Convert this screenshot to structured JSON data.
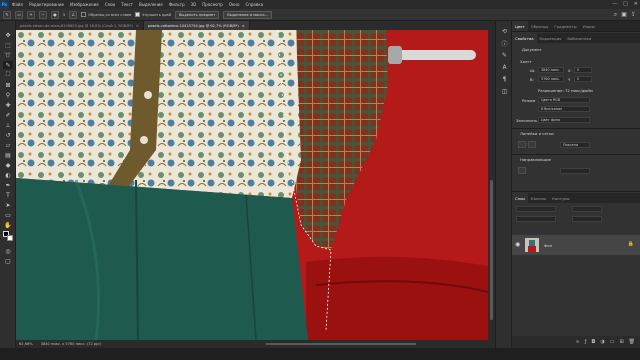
{
  "app": {
    "logo": "Ps"
  },
  "menu": [
    "Файл",
    "Редактирование",
    "Изображение",
    "Слои",
    "Текст",
    "Выделение",
    "Фильтр",
    "3D",
    "Просмотр",
    "Окно",
    "Справка"
  ],
  "window_controls": [
    "—",
    "□",
    "✕"
  ],
  "options": {
    "brush_size": "5",
    "sample_all_label": "Образец со всех слоев",
    "enhance_label": "Улучшить край",
    "select_subject_btn": "Выделить предмет",
    "select_mask_btn": "Выделение и маска..."
  },
  "tabs": [
    {
      "label": "pexels-edson-de-assis-8199803.jpg @ 18,8% (Слой 1, RGB/8*)",
      "active": false
    },
    {
      "label": "pexels-cottonbro-10415754.jpg @ 62,7% (RGB/8*)",
      "active": true
    }
  ],
  "status": {
    "zoom": "62,66%",
    "doc_size": "3840 пикс. x 5760 пикс. (72 ppi)"
  },
  "panels": {
    "top_tabs": [
      "Цвет",
      "Образцы",
      "Градиенты",
      "Узоры"
    ],
    "props_tabs": [
      "Свойства",
      "Коррекция",
      "Библиотеки"
    ],
    "doc_label": "Документ",
    "canvas_section": "Холст",
    "width_label": "Ш:",
    "width_val": "3840 пикс.",
    "height_label": "В:",
    "height_val": "5760 пикс.",
    "x_label": "X",
    "x_val": "0",
    "y_label": "Y",
    "y_val": "0",
    "resolution": "Разрешение: 72 пикс/дюйм",
    "mode_label": "Режим",
    "mode_val": "Цвета RGB",
    "depth_val": "8 бит/канал",
    "fill_label": "Заполнить",
    "fill_val": "Цвет фона",
    "rulers_section": "Линейки и сетки",
    "rulers_unit": "Пиксели",
    "guides_section": "Направляющие",
    "layers_tabs": [
      "Слои",
      "Каналы",
      "Контуры"
    ],
    "layer_name": "Фон"
  },
  "colors": {
    "canvas_red": "#b31a19",
    "fabric_green": "#1e5a4e",
    "accent_blue": "#31a8ff"
  }
}
